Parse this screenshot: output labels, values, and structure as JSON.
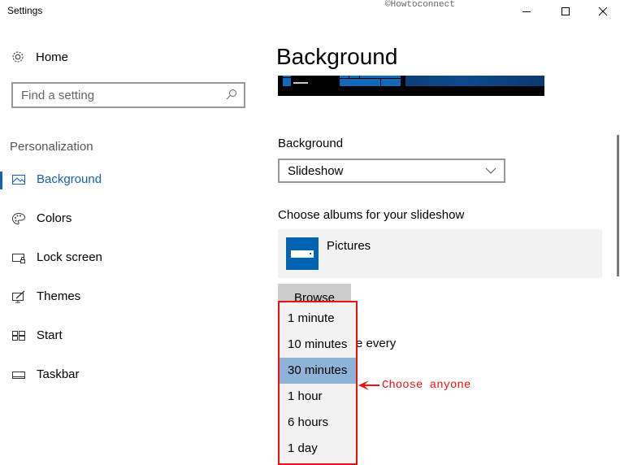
{
  "window": {
    "title": "Settings",
    "watermark": "©Howtoconnect",
    "controls": [
      "minimize",
      "maximize",
      "close"
    ]
  },
  "sidebar": {
    "home_label": "Home",
    "search_placeholder": "Find a setting",
    "section": "Personalization",
    "items": [
      {
        "label": "Background",
        "icon": "picture-icon",
        "active": true
      },
      {
        "label": "Colors",
        "icon": "palette-icon",
        "active": false
      },
      {
        "label": "Lock screen",
        "icon": "lock-screen-icon",
        "active": false
      },
      {
        "label": "Themes",
        "icon": "themes-icon",
        "active": false
      },
      {
        "label": "Start",
        "icon": "start-icon",
        "active": false
      },
      {
        "label": "Taskbar",
        "icon": "taskbar-icon",
        "active": false
      }
    ]
  },
  "main": {
    "title": "Background",
    "background_label": "Background",
    "background_value": "Slideshow",
    "albums_label": "Choose albums for your slideshow",
    "album_name": "Pictures",
    "browse_label": "Browse",
    "change_label_partial": "e every"
  },
  "interval_dropdown": {
    "options": [
      "1 minute",
      "10 minutes",
      "30 minutes",
      "1 hour",
      "6 hours",
      "1 day"
    ],
    "selected": "30 minutes"
  },
  "annotation": {
    "text": "Choose anyone",
    "color": "#e81010"
  },
  "colors": {
    "accent": "#1560b0",
    "selected_option": "#8db3d9",
    "album_tile": "#0063b1"
  }
}
